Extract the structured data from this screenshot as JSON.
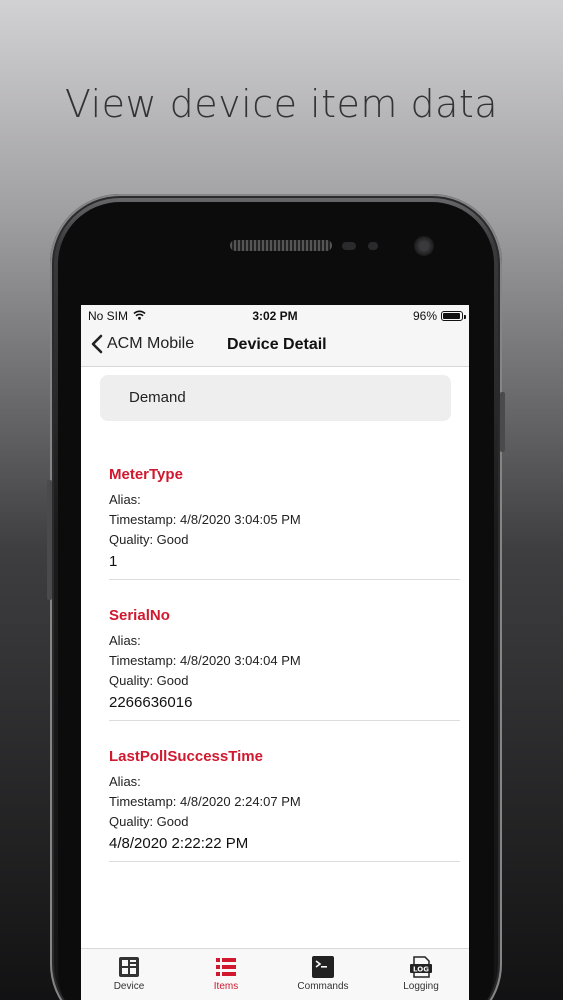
{
  "headline": "View device item data",
  "statusbar": {
    "carrier": "No SIM",
    "time": "3:02 PM",
    "battery": "96%",
    "battery_level": 0.96
  },
  "navbar": {
    "back_label": "ACM Mobile",
    "title": "Device Detail"
  },
  "group": {
    "label": "Demand"
  },
  "items": [
    {
      "name": "MeterType",
      "alias": "Alias:",
      "timestamp": "Timestamp: 4/8/2020 3:04:05 PM",
      "quality": "Quality: Good",
      "value": "1"
    },
    {
      "name": "SerialNo",
      "alias": "Alias:",
      "timestamp": "Timestamp: 4/8/2020 3:04:04 PM",
      "quality": "Quality: Good",
      "value": "2266636016"
    },
    {
      "name": "LastPollSuccessTime",
      "alias": "Alias:",
      "timestamp": "Timestamp: 4/8/2020 2:24:07 PM",
      "quality": "Quality: Good",
      "value": "4/8/2020 2:22:22 PM"
    }
  ],
  "tabs": [
    {
      "label": "Device",
      "icon": "device-icon",
      "active": false
    },
    {
      "label": "Items",
      "icon": "list-icon",
      "active": true
    },
    {
      "label": "Commands",
      "icon": "terminal-icon",
      "active": false
    },
    {
      "label": "Logging",
      "icon": "log-icon",
      "active": false
    }
  ],
  "colors": {
    "accent": "#d0192f",
    "background": "#ffffff",
    "navbar": "#f6f6f6",
    "group_header": "#eeeeef"
  }
}
